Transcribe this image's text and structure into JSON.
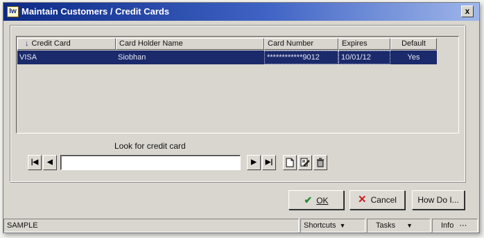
{
  "window": {
    "title": "Maintain Customers / Credit Cards",
    "app_icon_text": "Iw",
    "close_label": "x"
  },
  "table": {
    "sort_arrow": "↓",
    "columns": [
      "Credit Card",
      "Card Holder Name",
      "Card Number",
      "Expires",
      "Default"
    ],
    "rows": [
      {
        "credit_card": "VISA",
        "card_holder_name": "Siobhan",
        "card_number": "************9012",
        "expires": "10/01/12",
        "default": "Yes",
        "selected": true
      }
    ],
    "selection_color": "#1b2a6b"
  },
  "search": {
    "label": "Look for credit card",
    "value": ""
  },
  "navigation": {
    "first": "|◀",
    "previous": "◀",
    "next": "▶",
    "last": "▶|"
  },
  "buttons": {
    "ok": "OK",
    "cancel": "Cancel",
    "how_do_i": "How Do I..."
  },
  "status_bar": {
    "company": "SAMPLE",
    "shortcuts": "Shortcuts",
    "tasks": "Tasks",
    "info": "Info"
  },
  "icons": {
    "new": "new-document-icon",
    "edit": "edit-icon",
    "delete": "trash-icon"
  }
}
